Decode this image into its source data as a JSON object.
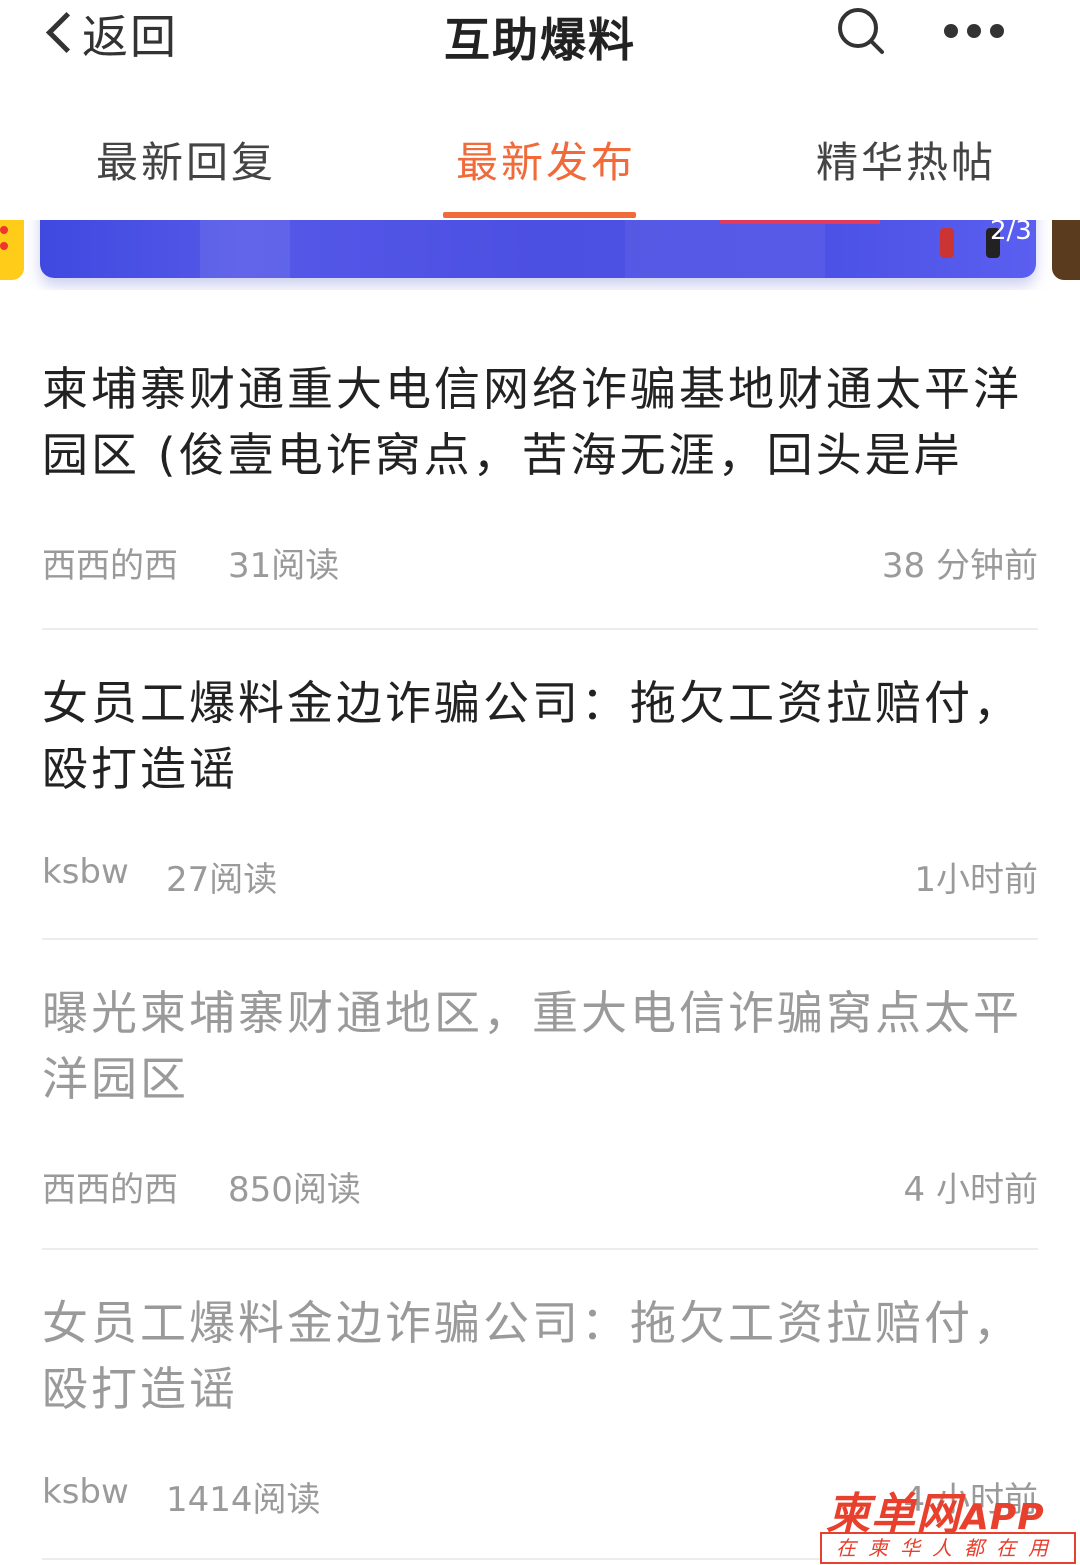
{
  "header": {
    "back_label": "返回",
    "title": "互助爆料",
    "search_icon": "search-icon",
    "more_icon": "more-dots-icon"
  },
  "tabs": [
    {
      "label": "最新回复",
      "active": false
    },
    {
      "label": "最新发布",
      "active": true
    },
    {
      "label": "精华热帖",
      "active": false
    }
  ],
  "accent_color": "#f06a3a",
  "banner": {
    "counter": "2/3"
  },
  "posts": [
    {
      "title": "柬埔寨财通重大电信网络诈骗基地财通太平洋园区 (俊壹电诈窝点，苦海无涯，回头是岸",
      "author": "西西的西",
      "reads": "31阅读",
      "time": "38 分钟前",
      "read": false
    },
    {
      "title": "女员工爆料金边诈骗公司：拖欠工资拉赔付，殴打造谣",
      "author": "ksbw",
      "reads": "27阅读",
      "time": "1小时前",
      "read": false
    },
    {
      "title": "曝光柬埔寨财通地区，重大电信诈骗窝点太平洋园区",
      "author": "西西的西",
      "reads": "850阅读",
      "time": "4 小时前",
      "read": true
    },
    {
      "title": "女员工爆料金边诈骗公司：拖欠工资拉赔付，殴打造谣",
      "author": "ksbw",
      "reads": "1414阅读",
      "time": "4 小时前",
      "read": true
    }
  ],
  "watermark": {
    "brand": "柬单网",
    "app": "APP",
    "slogan": "在柬华人都在用"
  }
}
